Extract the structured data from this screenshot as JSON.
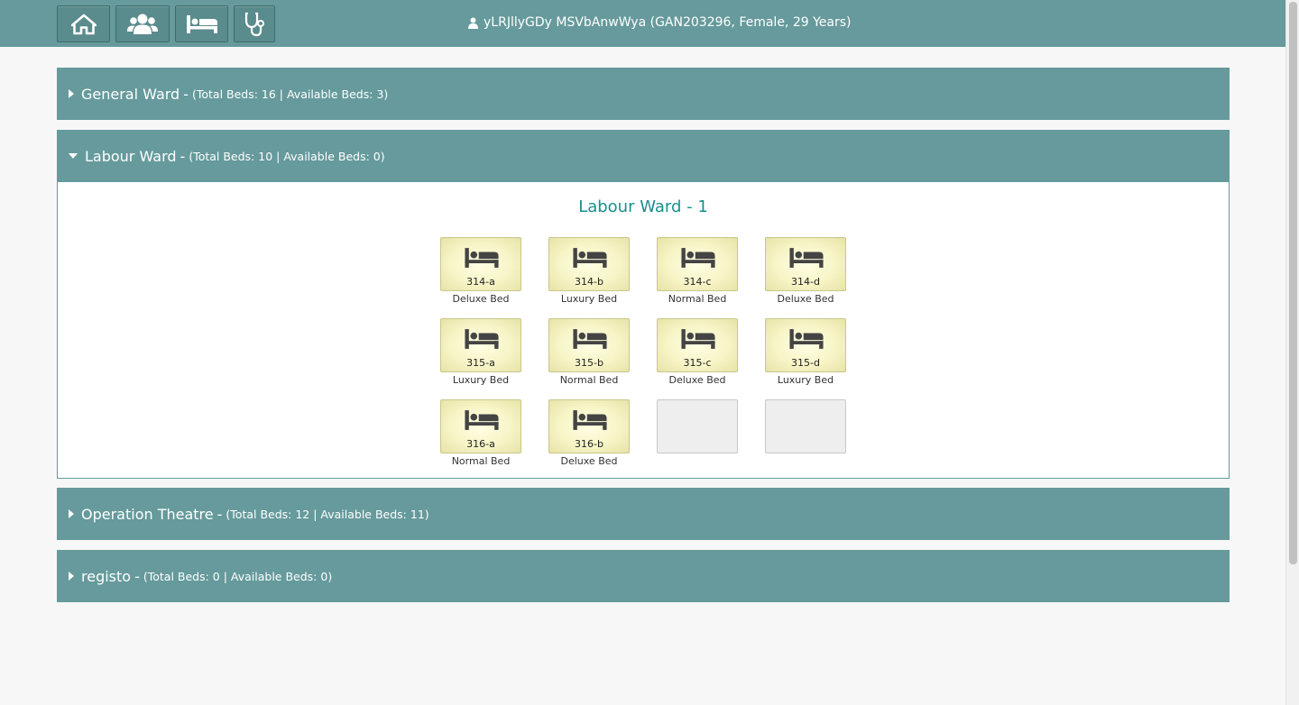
{
  "header": {
    "nav": [
      {
        "icon": "home-icon"
      },
      {
        "icon": "users-icon"
      },
      {
        "icon": "bed-icon"
      },
      {
        "icon": "stethoscope-icon"
      }
    ],
    "patient_icon": "user-icon",
    "patient_text": "yLRJllyGDy MSVbAnwWya (GAN203296, Female, 29 Years)"
  },
  "wards": [
    {
      "name": "General Ward",
      "sep": "-",
      "stats": "(Total Beds: 16 | Available Beds: 3)",
      "expanded": false
    },
    {
      "name": "Labour Ward",
      "sep": "-",
      "stats": "(Total Beds: 10 | Available Beds: 0)",
      "expanded": true
    },
    {
      "name": "Operation Theatre",
      "sep": "-",
      "stats": "(Total Beds: 12 | Available Beds: 11)",
      "expanded": false
    },
    {
      "name": "registo",
      "sep": "-",
      "stats": "(Total Beds: 0 | Available Beds: 0)",
      "expanded": false
    }
  ],
  "labour_room": {
    "title": "Labour Ward - 1",
    "beds": [
      {
        "number": "314-a",
        "type": "Deluxe Bed"
      },
      {
        "number": "314-b",
        "type": "Luxury Bed"
      },
      {
        "number": "314-c",
        "type": "Normal Bed"
      },
      {
        "number": "314-d",
        "type": "Deluxe Bed"
      },
      {
        "number": "315-a",
        "type": "Luxury Bed"
      },
      {
        "number": "315-b",
        "type": "Normal Bed"
      },
      {
        "number": "315-c",
        "type": "Deluxe Bed"
      },
      {
        "number": "315-d",
        "type": "Luxury Bed"
      },
      {
        "number": "316-a",
        "type": "Normal Bed"
      },
      {
        "number": "316-b",
        "type": "Deluxe Bed"
      }
    ]
  },
  "colors": {
    "header": "#669a9c",
    "room_title": "#1a8e8e",
    "bed_fill": "#f7f4c6"
  }
}
